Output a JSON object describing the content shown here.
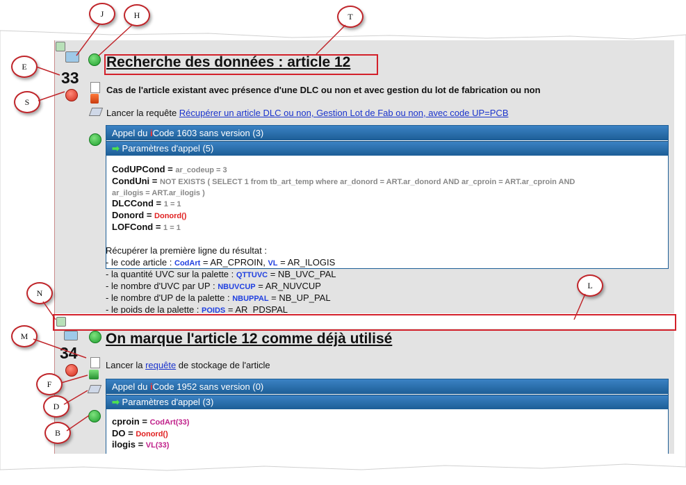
{
  "callouts": [
    "J",
    "H",
    "T",
    "E",
    "S",
    "N",
    "L",
    "M",
    "F",
    "D",
    "B"
  ],
  "step33": {
    "number": "33",
    "title": "Recherche des données : article 12",
    "description": "Cas de l'article existant avec présence d'une DLC ou non  et avec gestion du lot de fabrication ou non",
    "launch_prefix": "Lancer la requête ",
    "launch_link": "Récupérer un article DLC ou non, Gestion Lot de Fab ou non, avec code UP=PCB ",
    "call_title": "Appel du ",
    "call_i": "i",
    "call_suffix": "Code 1603 sans version (3)",
    "params_title": "Paramètres d'appel (5)",
    "params": [
      {
        "key": "CodUPCond",
        "eq": " = ",
        "val": "ar_codeup = 3"
      },
      {
        "key": "CondUni",
        "eq": " = ",
        "val": "NOT EXISTS ( SELECT 1 from tb_art_temp where ar_donord = ART.ar_donord AND ar_cproin = ART.ar_cproin AND",
        "val2": "ar_ilogis = ART.ar_ilogis )"
      },
      {
        "key": "DLCCond",
        "eq": " = ",
        "val": "1 = 1"
      },
      {
        "key": "Donord",
        "eq": " = ",
        "val": "Donord()"
      },
      {
        "key": "LOFCond",
        "eq": " = ",
        "val": "1 = 1"
      }
    ],
    "result_title": "Récupérer la première ligne du résultat :",
    "results": [
      {
        "pre": "- le code article : ",
        "var": "CodArt",
        "mid": " = AR_CPROIN, ",
        "var2": "VL",
        "post": " = AR_ILOGIS"
      },
      {
        "pre": "- la quantité UVC sur la palette : ",
        "var": "QTTUVC",
        "mid": " = NB_UVC_PAL",
        "var2": "",
        "post": ""
      },
      {
        "pre": "- le nombre d'UVC par UP : ",
        "var": "NBUVCUP",
        "mid": " = AR_NUVCUP",
        "var2": "",
        "post": ""
      },
      {
        "pre": "- le nombre d'UP de la palette : ",
        "var": "NBUPPAL",
        "mid": " = NB_UP_PAL",
        "var2": "",
        "post": ""
      },
      {
        "pre": "- le poids de la palette : ",
        "var": "POIDS",
        "mid": " = AR_PDSPAL",
        "var2": "",
        "post": ""
      }
    ]
  },
  "step34": {
    "number": "34",
    "title": "On marque l'article 12 comme déjà utilisé",
    "launch_prefix": "Lancer la ",
    "launch_link": "requête",
    "launch_suffix": " de stockage de l'article",
    "call_title": "Appel du ",
    "call_i": "i",
    "call_suffix": "Code 1952 sans version (0)",
    "params_title": "Paramètres d'appel (3)",
    "params": [
      {
        "key": "cproin",
        "eq": " = ",
        "val": "CodArt(33)"
      },
      {
        "key": "DO",
        "eq": " = ",
        "val": "Donord()"
      },
      {
        "key": "ilogis",
        "eq": " = ",
        "val": "VL(33)"
      }
    ]
  },
  "colors": {
    "accent_red": "#d3202a",
    "panel_blue": "#1d5e96",
    "green": "#1e9e2e"
  }
}
